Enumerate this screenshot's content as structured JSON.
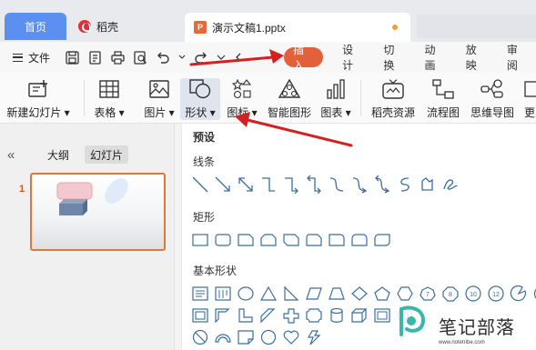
{
  "tabs": {
    "home": "首页",
    "daoke": "稻壳",
    "document": "演示文稿1.pptx"
  },
  "menu": {
    "file": "文件",
    "tabs": [
      "插入",
      "设计",
      "切换",
      "动画",
      "放映",
      "审阅"
    ],
    "active_tab": "插入"
  },
  "ribbon": {
    "buttons": [
      {
        "label": "新建幻灯片 ▾",
        "icon": "new-slide-icon"
      },
      {
        "label": "表格 ▾",
        "icon": "table-icon"
      },
      {
        "label": "图片 ▾",
        "icon": "picture-icon"
      },
      {
        "label": "形状 ▾",
        "icon": "shapes-icon"
      },
      {
        "label": "图标 ▾",
        "icon": "icons-icon"
      },
      {
        "label": "智能图形",
        "icon": "smart-graphic-icon"
      },
      {
        "label": "图表 ▾",
        "icon": "chart-icon"
      },
      {
        "label": "稻壳资源",
        "icon": "daoke-resources-icon"
      },
      {
        "label": "流程图",
        "icon": "flowchart-icon"
      },
      {
        "label": "思维导图",
        "icon": "mindmap-icon"
      },
      {
        "label": "更",
        "icon": "more-icon"
      }
    ]
  },
  "left_panel": {
    "outline_tab": "大纲",
    "slides_tab": "幻灯片",
    "slide_number": "1"
  },
  "shapes_dropdown": {
    "header": "预设",
    "sections": [
      "线条",
      "矩形",
      "基本形状"
    ],
    "basic_shape_labels": [
      "7",
      "8",
      "10",
      "12"
    ]
  },
  "watermark": {
    "title": "笔记部落",
    "url": "www.notetribe.com"
  },
  "colors": {
    "accent_insert": "#e2613a",
    "home_tab": "#5b8ff0",
    "shape_stroke": "#3a6ea5",
    "arrow": "#d42020"
  }
}
